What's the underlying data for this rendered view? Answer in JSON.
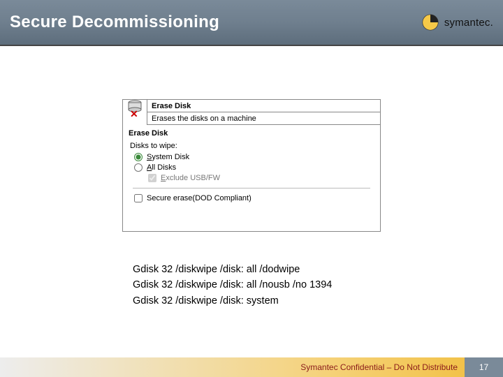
{
  "header": {
    "title": "Secure Decommissioning",
    "brand": "symantec."
  },
  "panel": {
    "row1": "Erase Disk",
    "row2": "Erases the disks on a machine",
    "section": "Erase Disk",
    "disks_label": "Disks to wipe:",
    "opt_system_pre": "S",
    "opt_system_post": "ystem Disk",
    "opt_all_pre": "A",
    "opt_all_post": "ll Disks",
    "opt_exclude_pre": "E",
    "opt_exclude_post": "xclude USB/FW",
    "opt_secure": "Secure erase(DOD Compliant)"
  },
  "commands": {
    "c1": "Gdisk 32 /diskwipe /disk: all /dodwipe",
    "c2": "Gdisk 32 /diskwipe /disk: all /nousb /no 1394",
    "c3": "Gdisk 32 /diskwipe /disk: system"
  },
  "footer": {
    "confidential": "Symantec Confidential – Do Not Distribute",
    "page": "17"
  }
}
